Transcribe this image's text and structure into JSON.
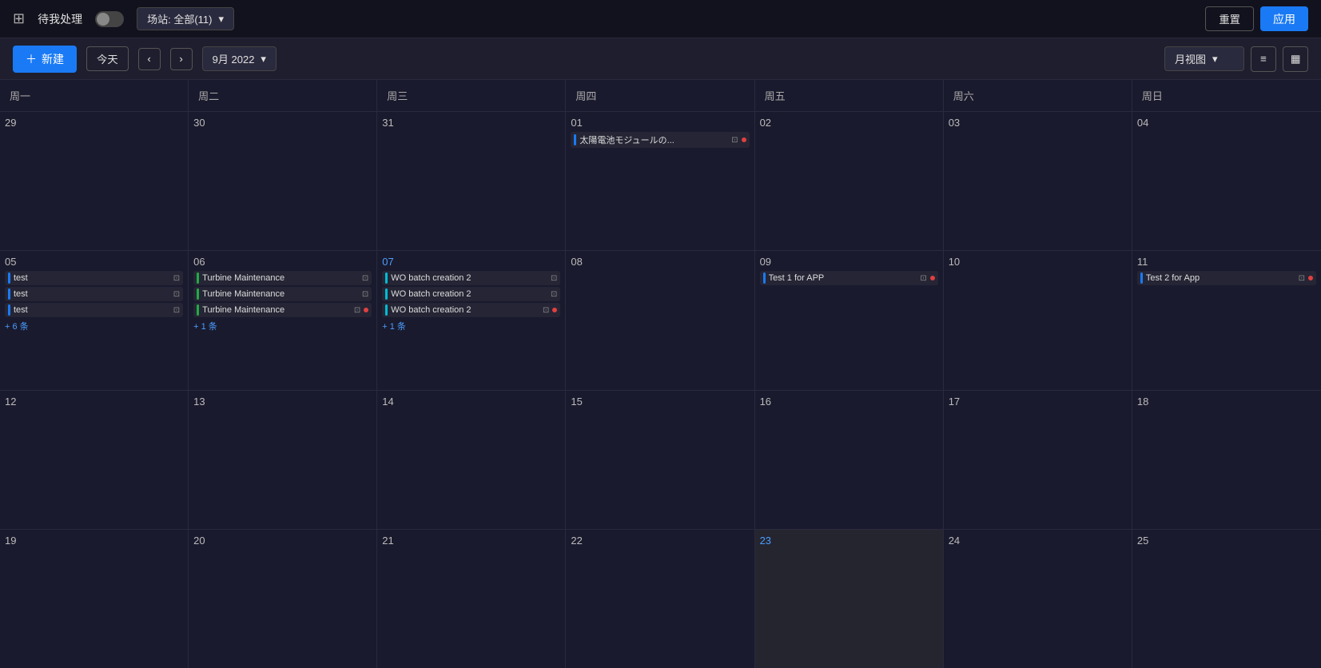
{
  "filterBar": {
    "logoIcon": "☰",
    "pendingLabel": "待我处理",
    "siteLabel": "场站: 全部(11)",
    "resetLabel": "重置",
    "applyLabel": "应用"
  },
  "toolbar": {
    "newLabel": "新建",
    "todayLabel": "今天",
    "prevIcon": "<",
    "nextIcon": ">",
    "monthLabel": "9月 2022",
    "viewLabel": "月视图",
    "menuIcon": "≡",
    "calendarIcon": "📅"
  },
  "weekHeaders": [
    "周一",
    "周二",
    "周三",
    "周四",
    "周五",
    "周六",
    "周日"
  ],
  "weeks": [
    {
      "days": [
        {
          "number": "29",
          "active": false,
          "events": [],
          "moreCount": null
        },
        {
          "number": "30",
          "active": false,
          "events": [],
          "moreCount": null
        },
        {
          "number": "31",
          "active": false,
          "events": [],
          "moreCount": null
        },
        {
          "number": "01",
          "active": false,
          "events": [
            {
              "label": "太陽電池モジュールの...",
              "bar": "bar-blue",
              "hasDot": true,
              "dotColor": "dot-red"
            }
          ],
          "moreCount": null
        },
        {
          "number": "02",
          "active": false,
          "events": [],
          "moreCount": null
        },
        {
          "number": "03",
          "active": false,
          "events": [],
          "moreCount": null
        },
        {
          "number": "04",
          "active": false,
          "events": [],
          "moreCount": null
        }
      ]
    },
    {
      "days": [
        {
          "number": "05",
          "active": false,
          "events": [
            {
              "label": "test",
              "bar": "bar-blue",
              "hasDot": false
            },
            {
              "label": "test",
              "bar": "bar-blue",
              "hasDot": false
            },
            {
              "label": "test",
              "bar": "bar-blue",
              "hasDot": false
            }
          ],
          "moreCount": "+ 6 条"
        },
        {
          "number": "06",
          "active": false,
          "events": [
            {
              "label": "Turbine Maintenance",
              "bar": "bar-green",
              "hasDot": false
            },
            {
              "label": "Turbine Maintenance",
              "bar": "bar-green",
              "hasDot": false
            },
            {
              "label": "Turbine Maintenance",
              "bar": "bar-green",
              "hasDot": true,
              "dotColor": "dot-red"
            }
          ],
          "moreCount": "+ 1 条"
        },
        {
          "number": "07",
          "active": true,
          "events": [
            {
              "label": "WO batch creation 2",
              "bar": "bar-cyan",
              "hasDot": false
            },
            {
              "label": "WO batch creation 2",
              "bar": "bar-cyan",
              "hasDot": false
            },
            {
              "label": "WO batch creation 2",
              "bar": "bar-cyan",
              "hasDot": true,
              "dotColor": "dot-red"
            }
          ],
          "moreCount": "+ 1 条"
        },
        {
          "number": "08",
          "active": false,
          "events": [],
          "moreCount": null
        },
        {
          "number": "09",
          "active": false,
          "events": [
            {
              "label": "Test 1 for APP",
              "bar": "bar-blue",
              "hasDot": true,
              "dotColor": "dot-red"
            }
          ],
          "moreCount": null
        },
        {
          "number": "10",
          "active": false,
          "events": [],
          "moreCount": null
        },
        {
          "number": "11",
          "active": false,
          "events": [
            {
              "label": "Test 2 for App",
              "bar": "bar-blue",
              "hasDot": true,
              "dotColor": "dot-red"
            }
          ],
          "moreCount": null
        }
      ]
    },
    {
      "days": [
        {
          "number": "12",
          "active": false,
          "events": [],
          "moreCount": null
        },
        {
          "number": "13",
          "active": false,
          "events": [],
          "moreCount": null
        },
        {
          "number": "14",
          "active": false,
          "events": [],
          "moreCount": null
        },
        {
          "number": "15",
          "active": false,
          "events": [],
          "moreCount": null
        },
        {
          "number": "16",
          "active": false,
          "events": [],
          "moreCount": null
        },
        {
          "number": "17",
          "active": false,
          "events": [],
          "moreCount": null
        },
        {
          "number": "18",
          "active": false,
          "events": [],
          "moreCount": null
        }
      ]
    },
    {
      "days": [
        {
          "number": "19",
          "active": false,
          "events": [],
          "moreCount": null
        },
        {
          "number": "20",
          "active": false,
          "events": [],
          "moreCount": null
        },
        {
          "number": "21",
          "active": false,
          "events": [],
          "moreCount": null
        },
        {
          "number": "22",
          "active": false,
          "events": [],
          "moreCount": null
        },
        {
          "number": "23",
          "active": true,
          "isToday": true,
          "events": [],
          "moreCount": null,
          "specialBg": true
        },
        {
          "number": "24",
          "active": false,
          "events": [],
          "moreCount": null
        },
        {
          "number": "25",
          "active": false,
          "events": [],
          "moreCount": null
        }
      ]
    }
  ]
}
